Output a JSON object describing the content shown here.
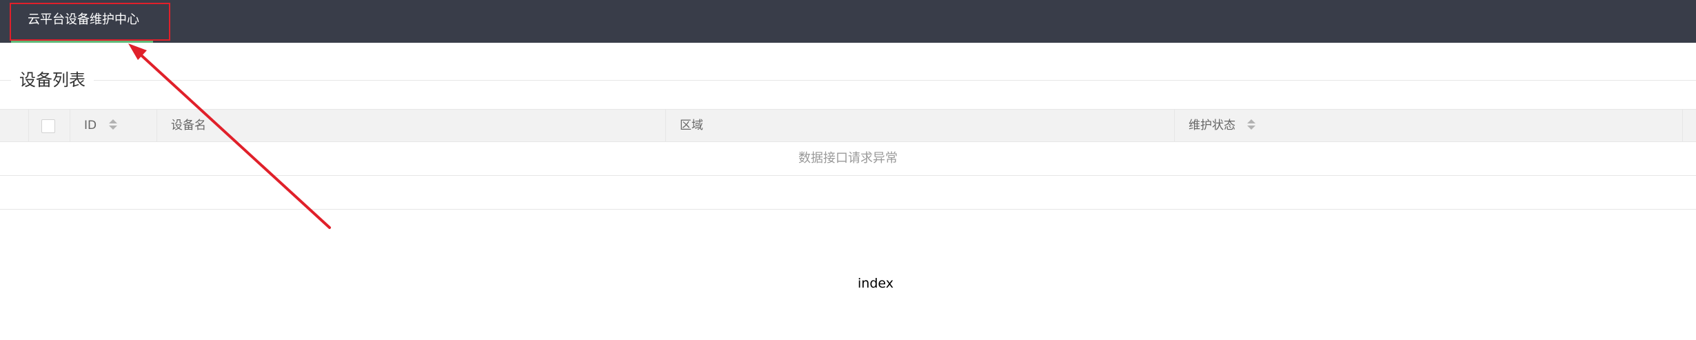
{
  "nav": {
    "active_item": "云平台设备维护中心"
  },
  "section": {
    "title": "设备列表"
  },
  "table": {
    "columns": {
      "id": "ID",
      "name": "设备名",
      "region": "区域",
      "status": "维护状态"
    },
    "empty_message": "数据接口请求异常"
  },
  "footer": {
    "text": "index"
  },
  "colors": {
    "topbar": "#393d49",
    "active_indicator": "#5fb878",
    "annotation": "#e0202a"
  },
  "icons": {
    "sort": "sort-arrows-icon",
    "annotation_arrow": "red-arrow-icon"
  }
}
